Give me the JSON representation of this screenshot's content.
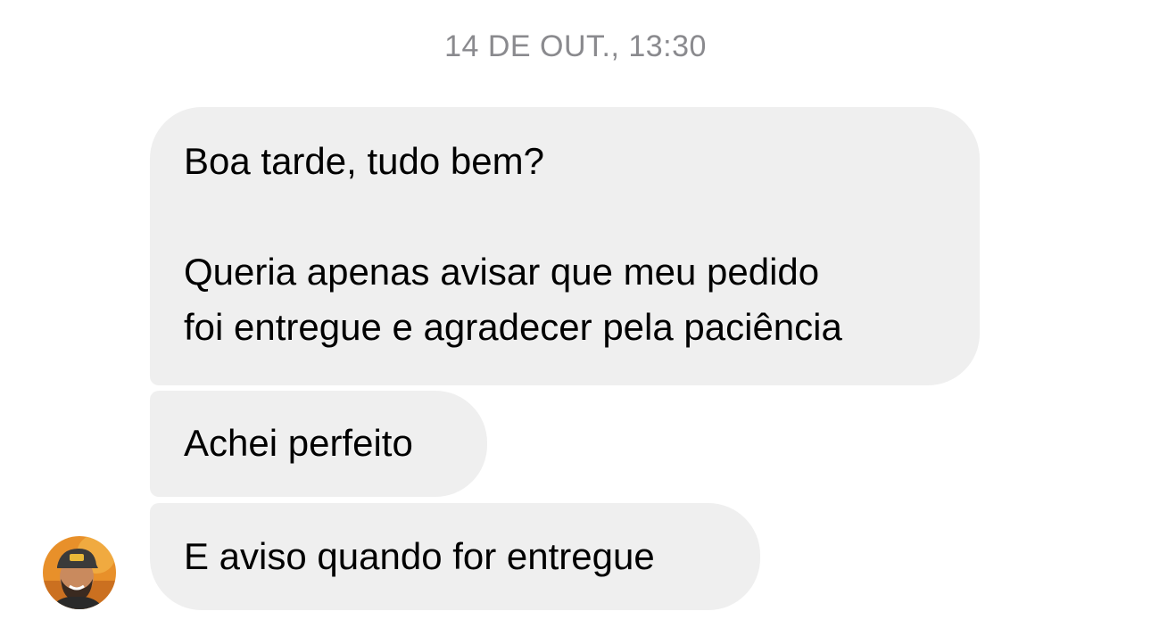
{
  "conversation": {
    "timestamp": "14 DE OUT., 13:30",
    "messages": [
      {
        "text": "Boa tarde, tudo bem?\n\nQueria apenas avisar que meu pedido\nfoi entregue e agradecer pela paciência"
      },
      {
        "text": "Achei perfeito"
      },
      {
        "text": "E aviso quando for entregue"
      }
    ]
  },
  "colors": {
    "bubble_background": "#efefef",
    "timestamp_text": "#8a8a8e",
    "avatar_background": "#e8902a"
  },
  "avatar": {
    "icon": "user-avatar-photo"
  }
}
